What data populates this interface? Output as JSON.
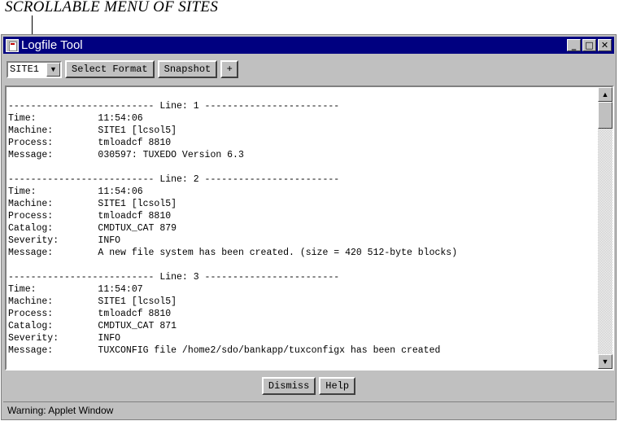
{
  "annotation": {
    "caption": "SCROLLABLE MENU OF SITES"
  },
  "window": {
    "title": "Logfile Tool",
    "controls": {
      "minimize": "_",
      "maximize": "□",
      "close": "✕"
    }
  },
  "toolbar": {
    "site_select": {
      "value": "SITE1",
      "icon": "chevron-down-icon"
    },
    "select_format_label": "Select Format",
    "snapshot_label": "Snapshot",
    "plus_label": "+"
  },
  "log_lines": [
    "-------------------------- Line: 1 ------------------------",
    "Time:           11:54:06",
    "Machine:        SITE1 [lcsol5]",
    "Process:        tmloadcf 8810",
    "Message:        030597: TUXEDO Version 6.3",
    "",
    "-------------------------- Line: 2 ------------------------",
    "Time:           11:54:06",
    "Machine:        SITE1 [lcsol5]",
    "Process:        tmloadcf 8810",
    "Catalog:        CMDTUX_CAT 879",
    "Severity:       INFO",
    "Message:        A new file system has been created. (size = 420 512-byte blocks)",
    "",
    "-------------------------- Line: 3 ------------------------",
    "Time:           11:54:07",
    "Machine:        SITE1 [lcsol5]",
    "Process:        tmloadcf 8810",
    "Catalog:        CMDTUX_CAT 871",
    "Severity:       INFO",
    "Message:        TUXCONFIG file /home2/sdo/bankapp/tuxconfigx has been created"
  ],
  "buttons": {
    "dismiss_label": "Dismiss",
    "help_label": "Help"
  },
  "status": {
    "text": "Warning: Applet Window"
  },
  "colors": {
    "titlebar": "#000080",
    "chrome": "#c0c0c0"
  }
}
